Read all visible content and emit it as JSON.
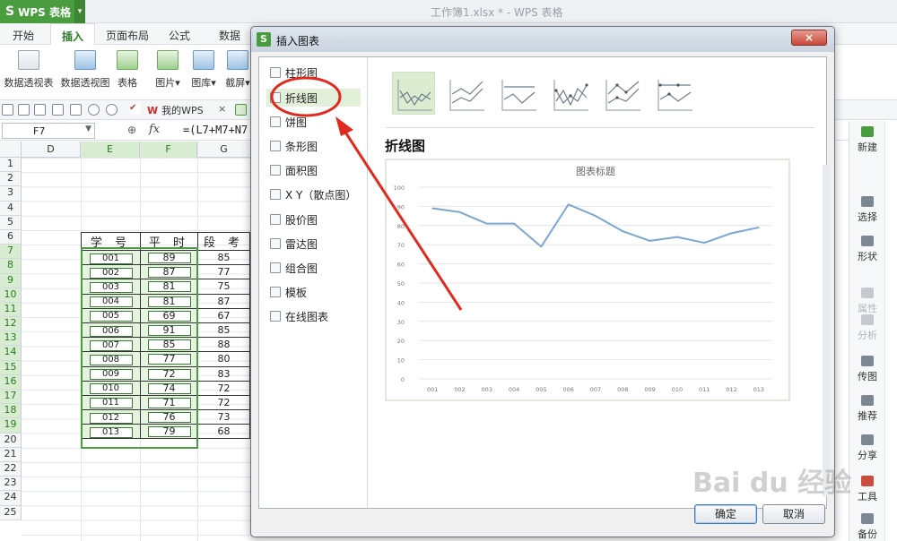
{
  "app": {
    "name": "WPS 表格",
    "logo": "S",
    "doc_title": "工作簿1.xlsx * - WPS 表格"
  },
  "ribbon_tabs": [
    "开始",
    "插入",
    "页面布局",
    "公式",
    "数据"
  ],
  "ribbon_buttons": [
    {
      "label": "数据透视表",
      "icon": "pivot-table-icon"
    },
    {
      "label": "数据透视图",
      "icon": "pivot-chart-icon"
    },
    {
      "label": "表格",
      "icon": "table-icon"
    },
    {
      "label": "图片▾",
      "icon": "picture-icon"
    },
    {
      "label": "图库▾",
      "icon": "gallery-icon"
    },
    {
      "label": "截屏▾",
      "icon": "screenshot-icon"
    }
  ],
  "quickbar": {
    "tab_label": "我的WPS",
    "close": "×"
  },
  "formula_bar": {
    "cell_ref": "F7",
    "fx": "fx",
    "formula": "=(L7+M7+N7"
  },
  "columns": [
    "D",
    "E",
    "F",
    "G"
  ],
  "rows": [
    "1",
    "2",
    "3",
    "4",
    "5",
    "6",
    "7",
    "8",
    "9",
    "10",
    "11",
    "12",
    "13",
    "14",
    "15",
    "16",
    "17",
    "18",
    "19",
    "20",
    "21",
    "22",
    "23",
    "24",
    "25"
  ],
  "table": {
    "headers": [
      "学 号",
      "平 时",
      "段 考"
    ],
    "rows": [
      [
        "001",
        "89",
        "85"
      ],
      [
        "002",
        "87",
        "77"
      ],
      [
        "003",
        "81",
        "75"
      ],
      [
        "004",
        "81",
        "87"
      ],
      [
        "005",
        "69",
        "67"
      ],
      [
        "006",
        "91",
        "85"
      ],
      [
        "007",
        "85",
        "88"
      ],
      [
        "008",
        "77",
        "80"
      ],
      [
        "009",
        "72",
        "83"
      ],
      [
        "010",
        "74",
        "72"
      ],
      [
        "011",
        "71",
        "72"
      ],
      [
        "012",
        "76",
        "73"
      ],
      [
        "013",
        "79",
        "68"
      ]
    ]
  },
  "right_panel": [
    {
      "label": "新建",
      "icon": "new-doc-icon",
      "state": "normal"
    },
    {
      "label": "选择",
      "icon": "select-icon",
      "state": "normal"
    },
    {
      "label": "形状",
      "icon": "shape-icon",
      "state": "normal"
    },
    {
      "label": "属性",
      "icon": "property-icon",
      "state": "dim"
    },
    {
      "label": "分析",
      "icon": "analysis-icon",
      "state": "dim"
    },
    {
      "label": "传图",
      "icon": "upload-image-icon",
      "state": "normal"
    },
    {
      "label": "推荐",
      "icon": "recommend-icon",
      "state": "normal"
    },
    {
      "label": "分享",
      "icon": "share-icon",
      "state": "normal"
    },
    {
      "label": "工具",
      "icon": "toolbox-icon",
      "state": "normal"
    },
    {
      "label": "备份",
      "icon": "backup-icon",
      "state": "normal"
    }
  ],
  "dialog": {
    "title": "插入图表",
    "close": "×",
    "chart_types": [
      {
        "label": "柱形图",
        "icon": "column-chart-icon"
      },
      {
        "label": "折线图",
        "icon": "line-chart-icon"
      },
      {
        "label": "饼图",
        "icon": "pie-chart-icon"
      },
      {
        "label": "条形图",
        "icon": "bar-chart-icon"
      },
      {
        "label": "面积图",
        "icon": "area-chart-icon"
      },
      {
        "label": "X Y（散点图）",
        "icon": "scatter-chart-icon"
      },
      {
        "label": "股价图",
        "icon": "stock-chart-icon"
      },
      {
        "label": "雷达图",
        "icon": "radar-chart-icon"
      },
      {
        "label": "组合图",
        "icon": "combo-chart-icon"
      },
      {
        "label": "模板",
        "icon": "template-icon"
      },
      {
        "label": "在线图表",
        "icon": "online-chart-icon"
      }
    ],
    "selected_type_heading": "折线图",
    "ok_label": "确定",
    "cancel_label": "取消"
  },
  "chart_data": {
    "type": "line",
    "title": "图表标题",
    "categories": [
      "001",
      "002",
      "003",
      "004",
      "005",
      "006",
      "007",
      "008",
      "009",
      "010",
      "011",
      "012",
      "013"
    ],
    "series": [
      {
        "values": [
          89,
          87,
          81,
          81,
          69,
          91,
          85,
          77,
          72,
          74,
          71,
          76,
          79
        ]
      }
    ],
    "ylim": [
      0,
      100
    ],
    "yticks": [
      0,
      10,
      20,
      30,
      40,
      50,
      60,
      70,
      80,
      90,
      100
    ],
    "grid": true,
    "line_color": "#7aa6d1"
  },
  "colors": {
    "wps_green": "#4a9d3f",
    "selection_fill": "#e6f3df",
    "annotation_red": "#e02a1e"
  },
  "watermark": "Bai du 经验"
}
